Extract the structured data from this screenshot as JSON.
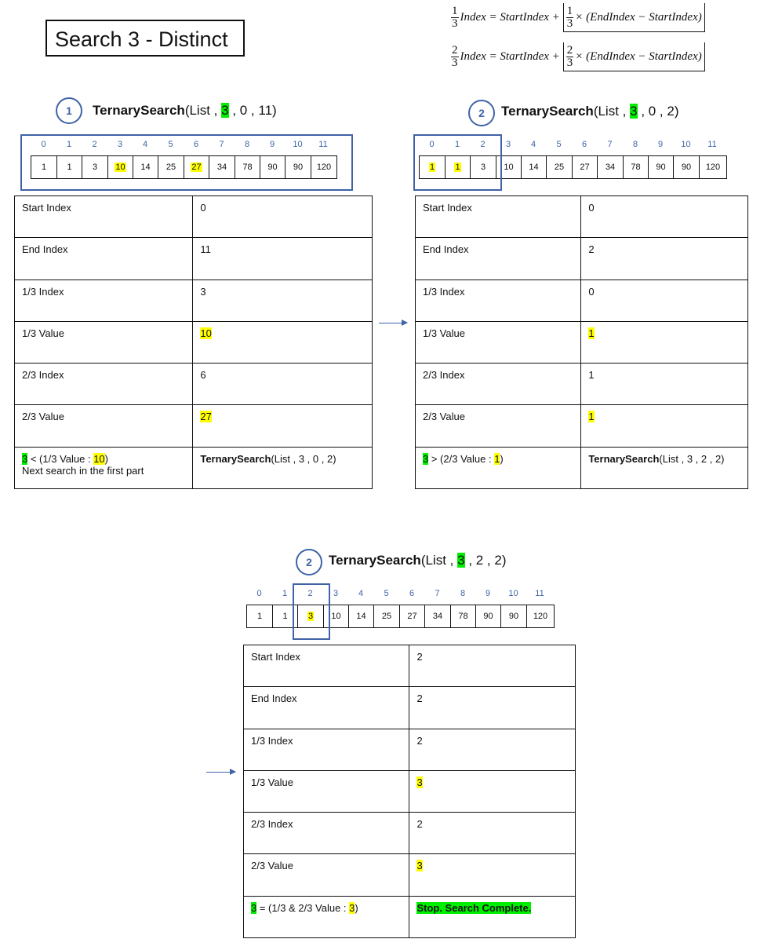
{
  "title": "Search 3 - Distinct",
  "formula": {
    "line1": {
      "num": "1",
      "den": "3",
      "lhs": "Index = StartIndex +",
      "inner_num": "1",
      "inner_den": "3",
      "rhs": "× (EndIndex − StartIndex)"
    },
    "line2": {
      "num": "2",
      "den": "3",
      "lhs": "Index = StartIndex +",
      "inner_num": "2",
      "inner_den": "3",
      "rhs": "× (EndIndex − StartIndex)"
    }
  },
  "list": [
    1,
    1,
    3,
    10,
    14,
    25,
    27,
    34,
    78,
    90,
    90,
    120
  ],
  "indices": [
    "0",
    "1",
    "2",
    "3",
    "4",
    "5",
    "6",
    "7",
    "8",
    "9",
    "10",
    "11"
  ],
  "steps": [
    {
      "circle": "1",
      "call_fn": "TernarySearch",
      "call_pre": "(List ,",
      "call_target": "3",
      "call_post": ", 0 , 11)",
      "highlight_cells": [
        3,
        6
      ],
      "rows": [
        {
          "label": "Start Index",
          "value": "0"
        },
        {
          "label": "End Index",
          "value": "11"
        },
        {
          "label": "1/3 Index",
          "value": "3"
        },
        {
          "label": "1/3 Value",
          "value": "10"
        },
        {
          "label": "2/3 Index",
          "value": "6"
        },
        {
          "label": "2/3 Value",
          "value": "27"
        }
      ],
      "result": {
        "target": "3",
        "cmp_pre": " < (1/3 Value : ",
        "cmp_val": "10",
        "cmp_post": ")",
        "note": "Next search in the first part",
        "next_fn": "TernarySearch",
        "next_args": "(List , 3 , 0 , 2)"
      }
    },
    {
      "circle": "2",
      "call_fn": "TernarySearch",
      "call_pre": "(List ,",
      "call_target": "3",
      "call_post": ", 0 , 2)",
      "highlight_cells": [
        0,
        1
      ],
      "rows": [
        {
          "label": "Start Index",
          "value": "0"
        },
        {
          "label": "End Index",
          "value": "2"
        },
        {
          "label": "1/3 Index",
          "value": "0"
        },
        {
          "label": "1/3 Value",
          "value": "1"
        },
        {
          "label": "2/3 Index",
          "value": "1"
        },
        {
          "label": "2/3 Value",
          "value": "1"
        }
      ],
      "result": {
        "target": "3",
        "cmp_pre": " > (2/3 Value : ",
        "cmp_val": "1",
        "cmp_post": ")",
        "note": "",
        "next_fn": "TernarySearch",
        "next_args": "(List , 3 , 2 , 2)"
      }
    },
    {
      "circle": "2",
      "call_fn": "TernarySearch",
      "call_pre": "(List ,",
      "call_target": "3",
      "call_post": ", 2 , 2)",
      "highlight_cells": [
        2
      ],
      "rows": [
        {
          "label": "Start Index",
          "value": "2"
        },
        {
          "label": "End Index",
          "value": "2"
        },
        {
          "label": "1/3 Index",
          "value": "2"
        },
        {
          "label": "1/3 Value",
          "value": "3"
        },
        {
          "label": "2/3 Index",
          "value": "2"
        },
        {
          "label": "2/3 Value",
          "value": "3"
        }
      ],
      "result": {
        "target": "3",
        "cmp_pre": " = (1/3 & 2/3 Value : ",
        "cmp_val": "3",
        "cmp_post": ")",
        "note": "",
        "next_fn": "Stop. Search Complete.",
        "next_args": ""
      }
    }
  ]
}
